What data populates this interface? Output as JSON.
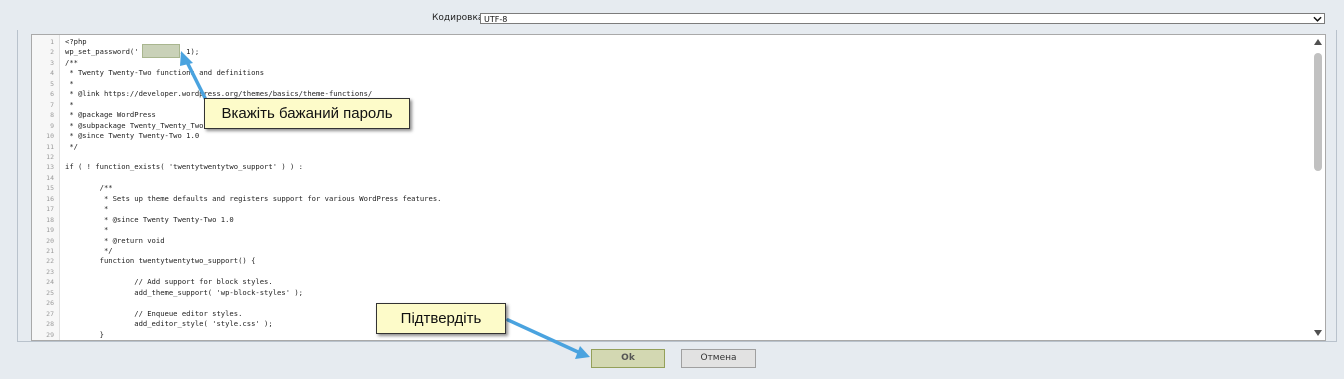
{
  "encoding": {
    "label": "Кодировка",
    "value": "UTF-8"
  },
  "editor": {
    "lines": [
      "<?php",
      "wp_set_password('        ', 1);",
      "/**",
      " * Twenty Twenty-Two functions and definitions",
      " *",
      " * @link https://developer.wordpress.org/themes/basics/theme-functions/",
      " *",
      " * @package WordPress",
      " * @subpackage Twenty_Twenty_Two",
      " * @since Twenty Twenty-Two 1.0",
      " */",
      "",
      "if ( ! function_exists( 'twentytwentytwo_support' ) ) :",
      "",
      "        /**",
      "         * Sets up theme defaults and registers support for various WordPress features.",
      "         *",
      "         * @since Twenty Twenty-Two 1.0",
      "         *",
      "         * @return void",
      "         */",
      "        function twentytwentytwo_support() {",
      "",
      "                // Add support for block styles.",
      "                add_theme_support( 'wp-block-styles' );",
      "",
      "                // Enqueue editor styles.",
      "                add_editor_style( 'style.css' );",
      "        }"
    ]
  },
  "callouts": {
    "password": "Вкажіть бажаний пароль",
    "confirm": "Підтвердіть"
  },
  "buttons": {
    "ok": "Ok",
    "cancel": "Отмена"
  },
  "colors": {
    "callout_bg": "#fdfbc9",
    "arrow": "#4aa3df",
    "ok_bg": "#d3d8b2"
  }
}
